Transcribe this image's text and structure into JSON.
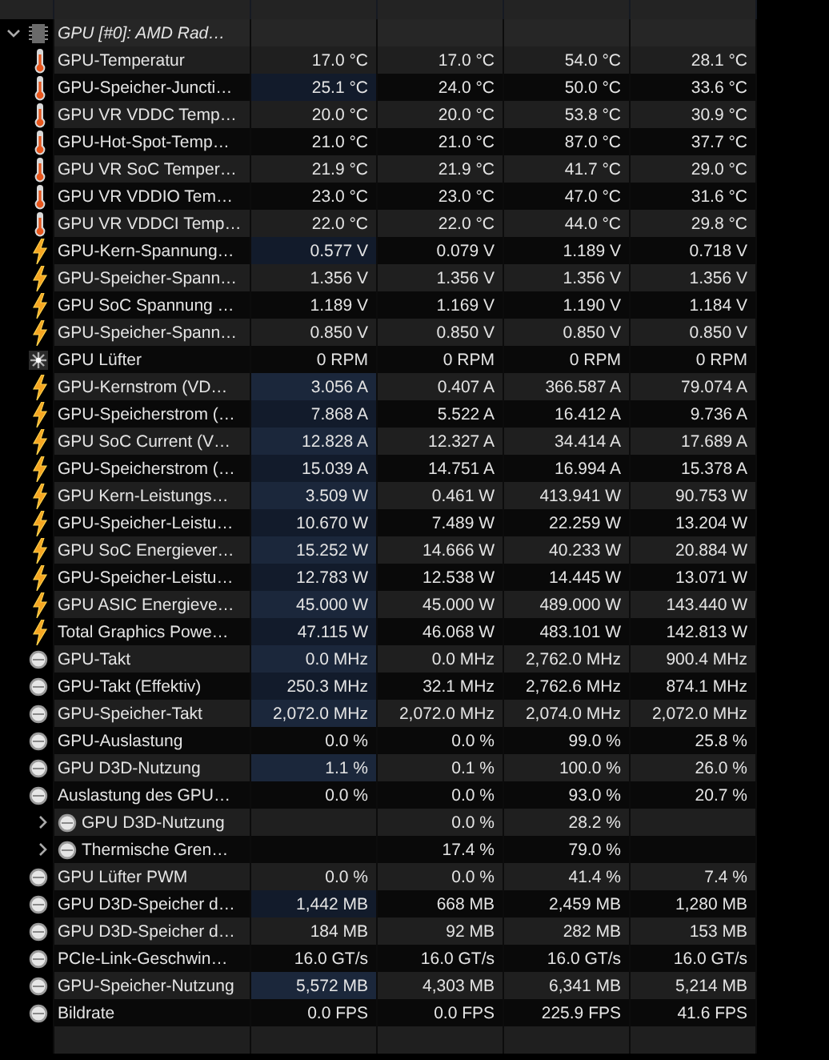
{
  "group": {
    "label": "GPU [#0]: AMD Rad…",
    "expanded": true,
    "rows": [
      {
        "kind": "thermometer",
        "label": "GPU-Temperatur",
        "current": "17.0 °C",
        "min": "17.0 °C",
        "max": "54.0 °C",
        "avg": "28.1 °C",
        "highlighted": false
      },
      {
        "kind": "thermometer",
        "label": "GPU-Speicher-Juncti…",
        "current": "25.1 °C",
        "min": "24.0 °C",
        "max": "50.0 °C",
        "avg": "33.6 °C",
        "highlighted": true
      },
      {
        "kind": "thermometer",
        "label": "GPU VR VDDC Temp…",
        "current": "20.0 °C",
        "min": "20.0 °C",
        "max": "53.8 °C",
        "avg": "30.9 °C",
        "highlighted": false
      },
      {
        "kind": "thermometer",
        "label": "GPU-Hot-Spot-Temp…",
        "current": "21.0 °C",
        "min": "21.0 °C",
        "max": "87.0 °C",
        "avg": "37.7 °C",
        "highlighted": false
      },
      {
        "kind": "thermometer",
        "label": "GPU VR SoC Temper…",
        "current": "21.9 °C",
        "min": "21.9 °C",
        "max": "41.7 °C",
        "avg": "29.0 °C",
        "highlighted": false
      },
      {
        "kind": "thermometer",
        "label": "GPU VR VDDIO Tem…",
        "current": "23.0 °C",
        "min": "23.0 °C",
        "max": "47.0 °C",
        "avg": "31.6 °C",
        "highlighted": false
      },
      {
        "kind": "thermometer",
        "label": "GPU VR VDDCI Temp…",
        "current": "22.0 °C",
        "min": "22.0 °C",
        "max": "44.0 °C",
        "avg": "29.8 °C",
        "highlighted": false
      },
      {
        "kind": "bolt",
        "label": "GPU-Kern-Spannung…",
        "current": "0.577 V",
        "min": "0.079 V",
        "max": "1.189 V",
        "avg": "0.718 V",
        "highlighted": true
      },
      {
        "kind": "bolt",
        "label": "GPU-Speicher-Spann…",
        "current": "1.356 V",
        "min": "1.356 V",
        "max": "1.356 V",
        "avg": "1.356 V",
        "highlighted": false
      },
      {
        "kind": "bolt",
        "label": "GPU SoC Spannung …",
        "current": "1.189 V",
        "min": "1.169 V",
        "max": "1.190 V",
        "avg": "1.184 V",
        "highlighted": false
      },
      {
        "kind": "bolt",
        "label": "GPU-Speicher-Spann…",
        "current": "0.850 V",
        "min": "0.850 V",
        "max": "0.850 V",
        "avg": "0.850 V",
        "highlighted": false
      },
      {
        "kind": "fan",
        "label": "GPU Lüfter",
        "current": "0 RPM",
        "min": "0 RPM",
        "max": "0 RPM",
        "avg": "0 RPM",
        "highlighted": false
      },
      {
        "kind": "bolt",
        "label": "GPU-Kernstrom (VD…",
        "current": "3.056 A",
        "min": "0.407 A",
        "max": "366.587 A",
        "avg": "79.074 A",
        "highlighted": true
      },
      {
        "kind": "bolt",
        "label": "GPU-Speicherstrom (…",
        "current": "7.868 A",
        "min": "5.522 A",
        "max": "16.412 A",
        "avg": "9.736 A",
        "highlighted": true
      },
      {
        "kind": "bolt",
        "label": "GPU SoC Current (V…",
        "current": "12.828 A",
        "min": "12.327 A",
        "max": "34.414 A",
        "avg": "17.689 A",
        "highlighted": true
      },
      {
        "kind": "bolt",
        "label": "GPU-Speicherstrom (…",
        "current": "15.039 A",
        "min": "14.751 A",
        "max": "16.994 A",
        "avg": "15.378 A",
        "highlighted": true
      },
      {
        "kind": "bolt",
        "label": "GPU Kern-Leistungs…",
        "current": "3.509 W",
        "min": "0.461 W",
        "max": "413.941 W",
        "avg": "90.753 W",
        "highlighted": true
      },
      {
        "kind": "bolt",
        "label": "GPU-Speicher-Leistu…",
        "current": "10.670 W",
        "min": "7.489 W",
        "max": "22.259 W",
        "avg": "13.204 W",
        "highlighted": true
      },
      {
        "kind": "bolt",
        "label": "GPU SoC Energiever…",
        "current": "15.252 W",
        "min": "14.666 W",
        "max": "40.233 W",
        "avg": "20.884 W",
        "highlighted": true
      },
      {
        "kind": "bolt",
        "label": "GPU-Speicher-Leistu…",
        "current": "12.783 W",
        "min": "12.538 W",
        "max": "14.445 W",
        "avg": "13.071 W",
        "highlighted": true
      },
      {
        "kind": "bolt",
        "label": "GPU ASIC Energieve…",
        "current": "45.000 W",
        "min": "45.000 W",
        "max": "489.000 W",
        "avg": "143.440 W",
        "highlighted": true
      },
      {
        "kind": "bolt",
        "label": "Total Graphics Powe…",
        "current": "47.115 W",
        "min": "46.068 W",
        "max": "483.101 W",
        "avg": "142.813 W",
        "highlighted": true
      },
      {
        "kind": "gauge",
        "label": "GPU-Takt",
        "current": "0.0 MHz",
        "min": "0.0 MHz",
        "max": "2,762.0 MHz",
        "avg": "900.4 MHz",
        "highlighted": true
      },
      {
        "kind": "gauge",
        "label": "GPU-Takt (Effektiv)",
        "current": "250.3 MHz",
        "min": "32.1 MHz",
        "max": "2,762.6 MHz",
        "avg": "874.1 MHz",
        "highlighted": true
      },
      {
        "kind": "gauge",
        "label": "GPU-Speicher-Takt",
        "current": "2,072.0 MHz",
        "min": "2,072.0 MHz",
        "max": "2,074.0 MHz",
        "avg": "2,072.0 MHz",
        "highlighted": true
      },
      {
        "kind": "gauge",
        "label": "GPU-Auslastung",
        "current": "0.0 %",
        "min": "0.0 %",
        "max": "99.0 %",
        "avg": "25.8 %",
        "highlighted": false
      },
      {
        "kind": "gauge",
        "label": "GPU D3D-Nutzung",
        "current": "1.1 %",
        "min": "0.1 %",
        "max": "100.0 %",
        "avg": "26.0 %",
        "highlighted": true
      },
      {
        "kind": "gauge",
        "label": "Auslastung des GPU…",
        "current": "0.0 %",
        "min": "0.0 %",
        "max": "93.0 %",
        "avg": "20.7 %",
        "highlighted": false
      },
      {
        "kind": "gauge",
        "label": "GPU D3D-Nutzung",
        "min": "0.0 %",
        "max": "28.2 %",
        "highlighted": false,
        "expanded": false
      },
      {
        "kind": "gauge",
        "label": "Thermische Gren…",
        "min": "17.4 %",
        "max": "79.0 %",
        "highlighted": false,
        "expanded": false
      },
      {
        "kind": "gauge",
        "label": "GPU Lüfter PWM",
        "current": "0.0 %",
        "min": "0.0 %",
        "max": "41.4 %",
        "avg": "7.4 %",
        "highlighted": false
      },
      {
        "kind": "gauge",
        "label": "GPU D3D-Speicher d…",
        "current": "1,442 MB",
        "min": "668 MB",
        "max": "2,459 MB",
        "avg": "1,280 MB",
        "highlighted": true
      },
      {
        "kind": "gauge",
        "label": "GPU D3D-Speicher d…",
        "current": "184 MB",
        "min": "92 MB",
        "max": "282 MB",
        "avg": "153 MB",
        "highlighted": false
      },
      {
        "kind": "gauge",
        "label": "PCIe-Link-Geschwin…",
        "current": "16.0 GT/s",
        "min": "16.0 GT/s",
        "max": "16.0 GT/s",
        "avg": "16.0 GT/s",
        "highlighted": false
      },
      {
        "kind": "gauge",
        "label": "GPU-Speicher-Nutzung",
        "current": "5,572 MB",
        "min": "4,303 MB",
        "max": "6,341 MB",
        "avg": "5,214 MB",
        "highlighted": true
      },
      {
        "kind": "gauge",
        "label": "Bildrate",
        "current": "0.0 FPS",
        "min": "0.0 FPS",
        "max": "225.9 FPS",
        "avg": "41.6 FPS",
        "highlighted": false
      }
    ]
  }
}
